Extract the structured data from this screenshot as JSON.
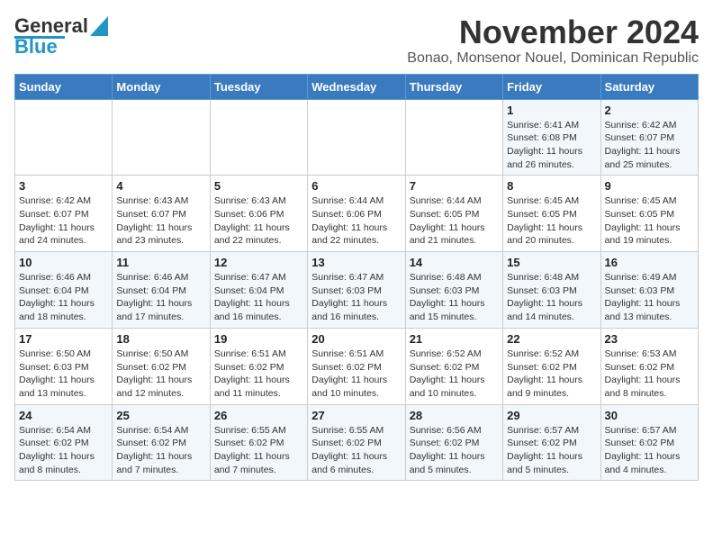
{
  "logo": {
    "line1": "General",
    "line2": "Blue"
  },
  "title": "November 2024",
  "subtitle": "Bonao, Monsenor Nouel, Dominican Republic",
  "days_of_week": [
    "Sunday",
    "Monday",
    "Tuesday",
    "Wednesday",
    "Thursday",
    "Friday",
    "Saturday"
  ],
  "weeks": [
    [
      {
        "num": "",
        "info": ""
      },
      {
        "num": "",
        "info": ""
      },
      {
        "num": "",
        "info": ""
      },
      {
        "num": "",
        "info": ""
      },
      {
        "num": "",
        "info": ""
      },
      {
        "num": "1",
        "info": "Sunrise: 6:41 AM\nSunset: 6:08 PM\nDaylight: 11 hours and 26 minutes."
      },
      {
        "num": "2",
        "info": "Sunrise: 6:42 AM\nSunset: 6:07 PM\nDaylight: 11 hours and 25 minutes."
      }
    ],
    [
      {
        "num": "3",
        "info": "Sunrise: 6:42 AM\nSunset: 6:07 PM\nDaylight: 11 hours and 24 minutes."
      },
      {
        "num": "4",
        "info": "Sunrise: 6:43 AM\nSunset: 6:07 PM\nDaylight: 11 hours and 23 minutes."
      },
      {
        "num": "5",
        "info": "Sunrise: 6:43 AM\nSunset: 6:06 PM\nDaylight: 11 hours and 22 minutes."
      },
      {
        "num": "6",
        "info": "Sunrise: 6:44 AM\nSunset: 6:06 PM\nDaylight: 11 hours and 22 minutes."
      },
      {
        "num": "7",
        "info": "Sunrise: 6:44 AM\nSunset: 6:05 PM\nDaylight: 11 hours and 21 minutes."
      },
      {
        "num": "8",
        "info": "Sunrise: 6:45 AM\nSunset: 6:05 PM\nDaylight: 11 hours and 20 minutes."
      },
      {
        "num": "9",
        "info": "Sunrise: 6:45 AM\nSunset: 6:05 PM\nDaylight: 11 hours and 19 minutes."
      }
    ],
    [
      {
        "num": "10",
        "info": "Sunrise: 6:46 AM\nSunset: 6:04 PM\nDaylight: 11 hours and 18 minutes."
      },
      {
        "num": "11",
        "info": "Sunrise: 6:46 AM\nSunset: 6:04 PM\nDaylight: 11 hours and 17 minutes."
      },
      {
        "num": "12",
        "info": "Sunrise: 6:47 AM\nSunset: 6:04 PM\nDaylight: 11 hours and 16 minutes."
      },
      {
        "num": "13",
        "info": "Sunrise: 6:47 AM\nSunset: 6:03 PM\nDaylight: 11 hours and 16 minutes."
      },
      {
        "num": "14",
        "info": "Sunrise: 6:48 AM\nSunset: 6:03 PM\nDaylight: 11 hours and 15 minutes."
      },
      {
        "num": "15",
        "info": "Sunrise: 6:48 AM\nSunset: 6:03 PM\nDaylight: 11 hours and 14 minutes."
      },
      {
        "num": "16",
        "info": "Sunrise: 6:49 AM\nSunset: 6:03 PM\nDaylight: 11 hours and 13 minutes."
      }
    ],
    [
      {
        "num": "17",
        "info": "Sunrise: 6:50 AM\nSunset: 6:03 PM\nDaylight: 11 hours and 13 minutes."
      },
      {
        "num": "18",
        "info": "Sunrise: 6:50 AM\nSunset: 6:02 PM\nDaylight: 11 hours and 12 minutes."
      },
      {
        "num": "19",
        "info": "Sunrise: 6:51 AM\nSunset: 6:02 PM\nDaylight: 11 hours and 11 minutes."
      },
      {
        "num": "20",
        "info": "Sunrise: 6:51 AM\nSunset: 6:02 PM\nDaylight: 11 hours and 10 minutes."
      },
      {
        "num": "21",
        "info": "Sunrise: 6:52 AM\nSunset: 6:02 PM\nDaylight: 11 hours and 10 minutes."
      },
      {
        "num": "22",
        "info": "Sunrise: 6:52 AM\nSunset: 6:02 PM\nDaylight: 11 hours and 9 minutes."
      },
      {
        "num": "23",
        "info": "Sunrise: 6:53 AM\nSunset: 6:02 PM\nDaylight: 11 hours and 8 minutes."
      }
    ],
    [
      {
        "num": "24",
        "info": "Sunrise: 6:54 AM\nSunset: 6:02 PM\nDaylight: 11 hours and 8 minutes."
      },
      {
        "num": "25",
        "info": "Sunrise: 6:54 AM\nSunset: 6:02 PM\nDaylight: 11 hours and 7 minutes."
      },
      {
        "num": "26",
        "info": "Sunrise: 6:55 AM\nSunset: 6:02 PM\nDaylight: 11 hours and 7 minutes."
      },
      {
        "num": "27",
        "info": "Sunrise: 6:55 AM\nSunset: 6:02 PM\nDaylight: 11 hours and 6 minutes."
      },
      {
        "num": "28",
        "info": "Sunrise: 6:56 AM\nSunset: 6:02 PM\nDaylight: 11 hours and 5 minutes."
      },
      {
        "num": "29",
        "info": "Sunrise: 6:57 AM\nSunset: 6:02 PM\nDaylight: 11 hours and 5 minutes."
      },
      {
        "num": "30",
        "info": "Sunrise: 6:57 AM\nSunset: 6:02 PM\nDaylight: 11 hours and 4 minutes."
      }
    ]
  ]
}
